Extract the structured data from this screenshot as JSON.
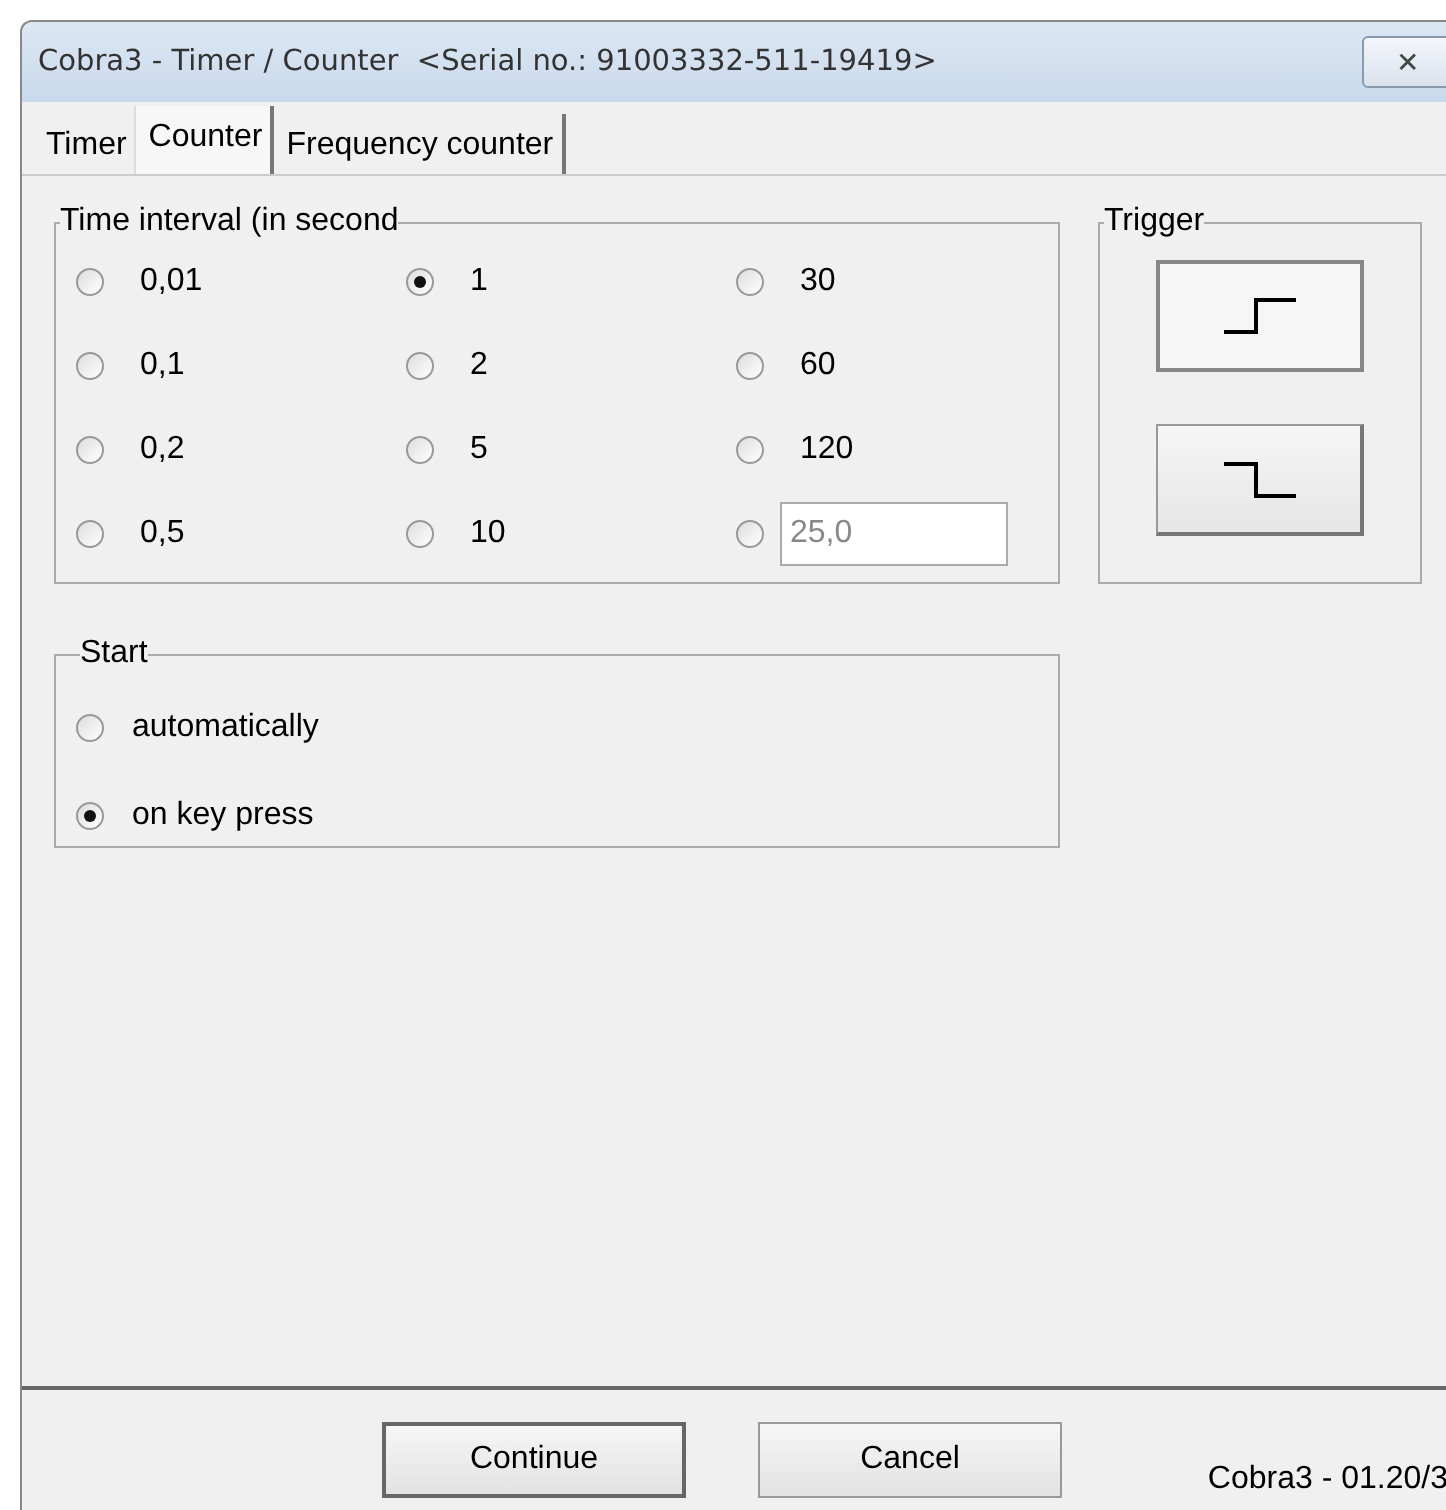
{
  "window": {
    "title": "Cobra3 - Timer / Counter  <Serial no.: 91003332-511-19419>",
    "close_label": "✕"
  },
  "tabs": [
    {
      "label": "Timer",
      "selected": false
    },
    {
      "label": "Counter",
      "selected": true
    },
    {
      "label": "Frequency counter",
      "selected": false
    }
  ],
  "time_interval": {
    "title": "Time interval (in second",
    "options": [
      {
        "kind": "radio",
        "label": "0,01",
        "selected": false
      },
      {
        "kind": "radio",
        "label": "1",
        "selected": true
      },
      {
        "kind": "radio",
        "label": "30",
        "selected": false
      },
      {
        "kind": "radio",
        "label": "0,1",
        "selected": false
      },
      {
        "kind": "radio",
        "label": "2",
        "selected": false
      },
      {
        "kind": "radio",
        "label": "60",
        "selected": false
      },
      {
        "kind": "radio",
        "label": "0,2",
        "selected": false
      },
      {
        "kind": "radio",
        "label": "5",
        "selected": false
      },
      {
        "kind": "radio",
        "label": "120",
        "selected": false
      },
      {
        "kind": "radio",
        "label": "0,5",
        "selected": false
      },
      {
        "kind": "radio",
        "label": "10",
        "selected": false
      },
      {
        "kind": "custom",
        "value": "25,0",
        "selected": false,
        "disabled": true
      }
    ]
  },
  "trigger": {
    "title": "Trigger",
    "options": [
      {
        "kind": "rising",
        "selected": true
      },
      {
        "kind": "falling",
        "selected": false
      }
    ]
  },
  "start": {
    "title": "Start",
    "options": [
      {
        "label": "automatically",
        "selected": false
      },
      {
        "label": "on key press",
        "selected": true
      }
    ]
  },
  "buttons": [
    {
      "label": "Continue",
      "default": true
    },
    {
      "label": "Cancel",
      "default": false
    }
  ],
  "status": "Cobra3 - 01.20/3"
}
